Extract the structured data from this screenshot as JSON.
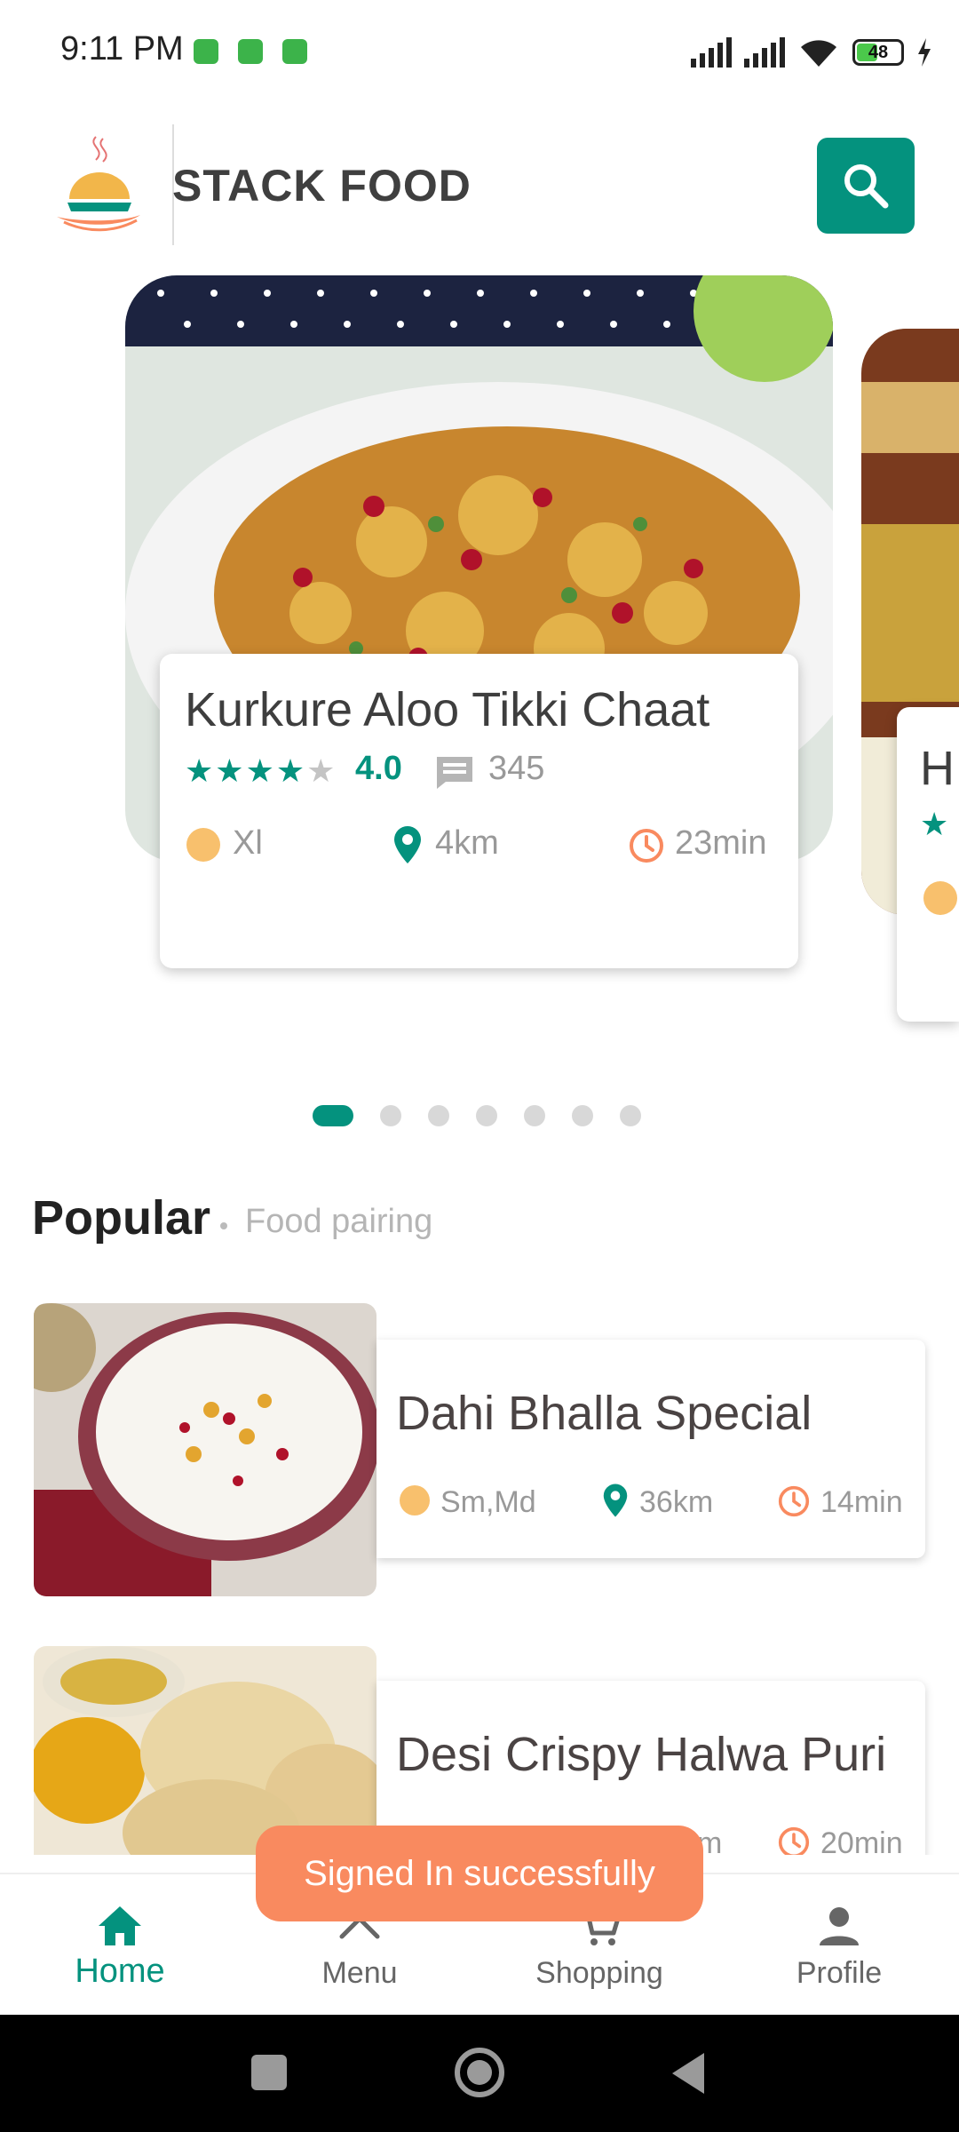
{
  "status_bar": {
    "time": "9:11 PM",
    "battery": "48",
    "battery_level": 0.48,
    "icons": [
      "whatsapp-icon",
      "android-icon",
      "android-icon",
      "signal-icon",
      "signal-icon",
      "wifi-icon",
      "battery-icon",
      "charging-icon"
    ]
  },
  "header": {
    "logo_text": "STACK FOOD",
    "search_icon": "search-icon"
  },
  "carousel": {
    "cards": [
      {
        "title": "Kurkure Aloo Tikki Chaat",
        "stars": 4,
        "rating": "4.0",
        "reviews": "345",
        "size": "Xl",
        "distance": "4km",
        "time": "23min"
      },
      {
        "title": "H"
      }
    ],
    "pages": 7,
    "active_page": 0
  },
  "popular": {
    "title": "Popular",
    "subtitle": "Food pairing",
    "items": [
      {
        "title": "Dahi Bhalla Special",
        "size": "Sm,Md",
        "distance": "36km",
        "time": "14min"
      },
      {
        "title": "Desi Crispy Halwa Puri",
        "distance": "km",
        "time": "20min"
      }
    ]
  },
  "toast": {
    "message": "Signed In successfully"
  },
  "bottom_nav": {
    "items": [
      {
        "label": "Home",
        "icon": "home-icon",
        "active": true
      },
      {
        "label": "Menu",
        "icon": "menu-icon"
      },
      {
        "label": "Shopping",
        "icon": "cart-icon"
      },
      {
        "label": "Profile",
        "icon": "person-icon"
      }
    ]
  },
  "colors": {
    "accent": "#04927e",
    "orange": "#f98a5f",
    "size_dot": "#f8c06d"
  }
}
